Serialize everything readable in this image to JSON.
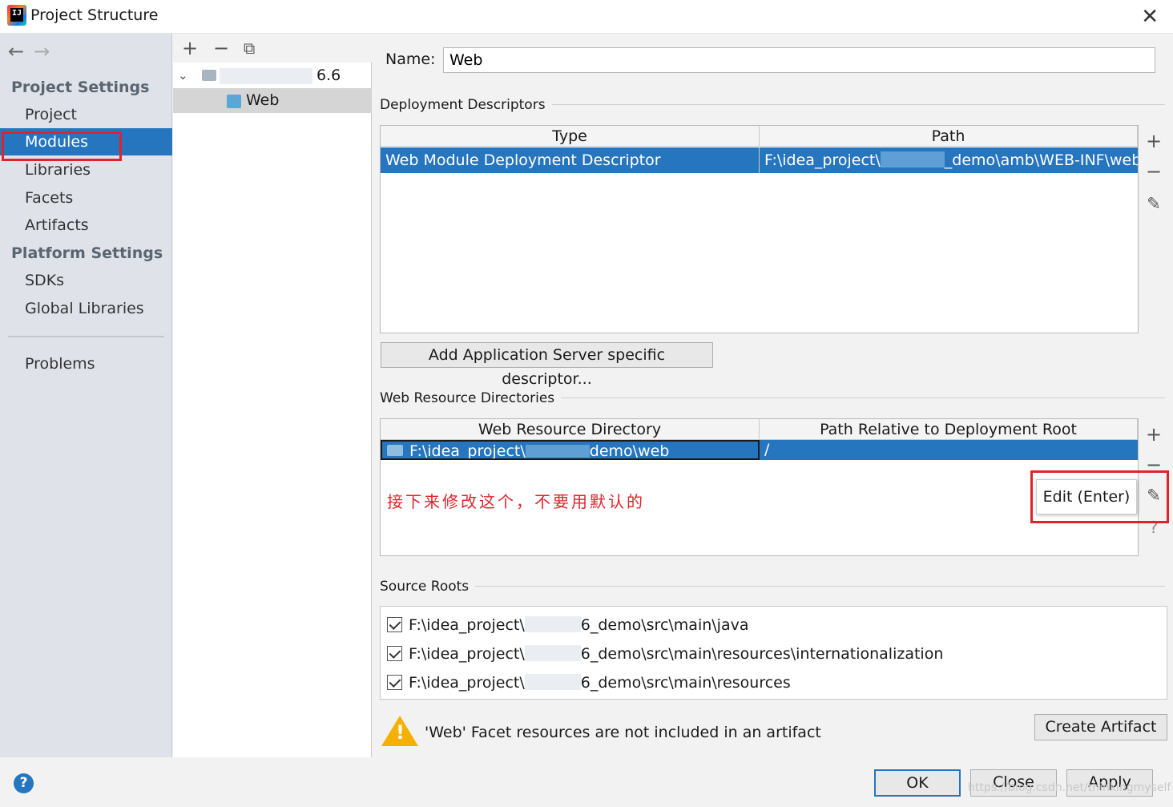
{
  "window": {
    "title": "Project Structure"
  },
  "sidebar": {
    "project_settings_heading": "Project Settings",
    "platform_settings_heading": "Platform Settings",
    "items": [
      {
        "label": "Project"
      },
      {
        "label": "Modules"
      },
      {
        "label": "Libraries"
      },
      {
        "label": "Facets"
      },
      {
        "label": "Artifacts"
      },
      {
        "label": "SDKs"
      },
      {
        "label": "Global Libraries"
      },
      {
        "label": "Problems"
      }
    ]
  },
  "tree": {
    "module_suffix": "6.6",
    "facet": "Web"
  },
  "main": {
    "name_label": "Name:",
    "name_value": "Web",
    "deployment": {
      "title": "Deployment Descriptors",
      "col_type": "Type",
      "col_path": "Path",
      "row_type": "Web Module Deployment Descriptor",
      "row_path_a": "F:\\idea_project\\",
      "row_path_b": "_demo\\amb\\WEB-INF\\web.xml",
      "add_button": "Add Application Server specific descriptor..."
    },
    "web_resource": {
      "title": "Web Resource Directories",
      "col_dir": "Web Resource Directory",
      "col_rel": "Path Relative to Deployment Root",
      "row_dir_a": "F:\\idea_project\\",
      "row_dir_b": "demo\\web",
      "row_rel": "/",
      "annotation": "接下来修改这个，不要用默认的",
      "tooltip": "Edit (Enter)"
    },
    "source_roots": {
      "title": "Source Roots",
      "prefix": "F:\\idea_project\\",
      "rows": [
        {
          "suffix": "6_demo\\src\\main\\java"
        },
        {
          "suffix": "6_demo\\src\\main\\resources\\internationalization"
        },
        {
          "suffix": "6_demo\\src\\main\\resources"
        }
      ]
    },
    "warning": "'Web' Facet resources are not included in an artifact",
    "create_artifact": "Create Artifact"
  },
  "footer": {
    "ok": "OK",
    "close": "Close",
    "apply": "Apply",
    "watermark": "https://blog.csdn.net/thinkingmyself"
  },
  "colors": {
    "selection": "#2675bf",
    "annotation": "#e0232b",
    "warning": "#f6b000"
  }
}
